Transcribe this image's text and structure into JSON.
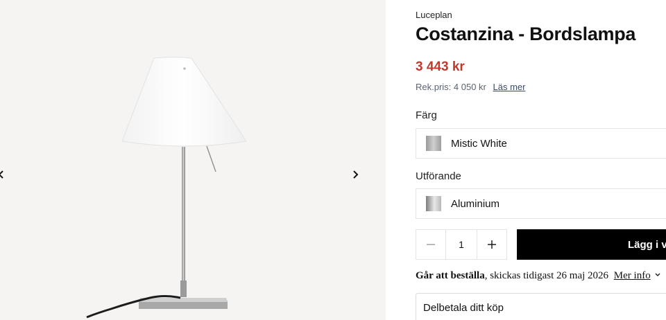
{
  "gallery": {
    "prev_icon": "chevron-left-icon",
    "next_icon": "chevron-right-icon",
    "image_icon": "table-lamp-image"
  },
  "product": {
    "brand": "Luceplan",
    "title": "Costanzina - Bordslampa",
    "price": "3 443 kr",
    "rek_price": "Rek.pris: 4 050 kr",
    "read_more": "Läs mer",
    "price_color": "#c0392b"
  },
  "options": {
    "color_label": "Färg",
    "color_value": "Mistic White",
    "finish_label": "Utförande",
    "finish_value": "Aluminium"
  },
  "cart": {
    "quantity": "1",
    "minus_icon": "minus-icon",
    "plus_icon": "plus-icon",
    "add_label": "Lägg i va"
  },
  "availability": {
    "status": "Går att beställa",
    "text": ", skickas tidigast 26 maj 2026",
    "more_info": "Mer info",
    "icon": "chevron-down-icon"
  },
  "installment": {
    "title": "Delbetala ditt köp"
  }
}
